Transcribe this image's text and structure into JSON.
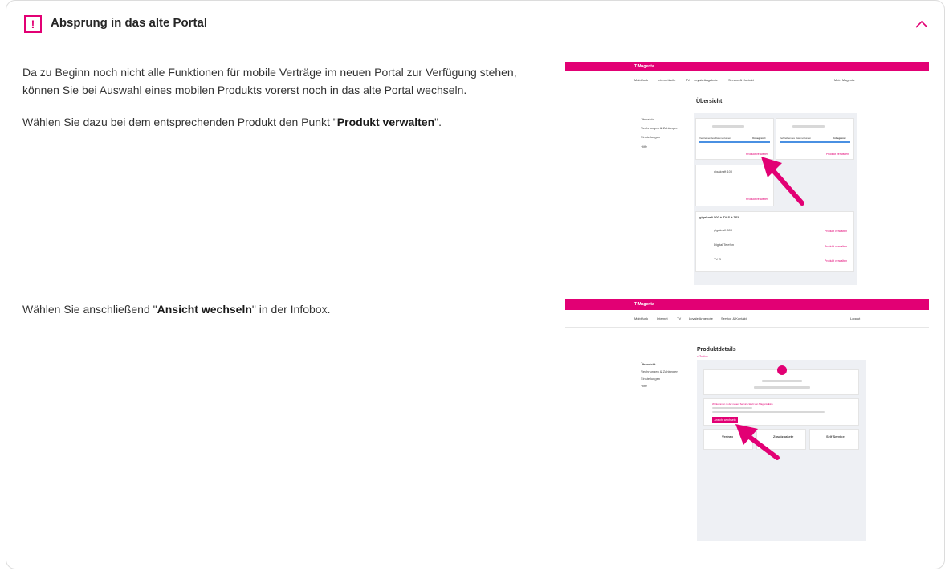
{
  "header": {
    "title": "Absprung in das alte Portal",
    "warning_glyph": "!",
    "accent_color": "#e20074"
  },
  "content": {
    "p1": "Da zu Beginn noch nicht alle Funktionen für mobile Verträge im neuen Portal zur Verfügung stehen, können Sie bei Auswahl eines mobilen Produkts vorerst noch in das alte Portal wechseln.",
    "p2_pre": "Wählen Sie dazu bei dem entsprechenden Produkt den Punkt \"",
    "p2_bold": "Produkt verwalten",
    "p2_post": "\".",
    "p3_pre": "Wählen Sie anschließend \"",
    "p3_bold": "Ansicht wechseln",
    "p3_post": "\" in der Infobox."
  },
  "shot1": {
    "brand": "T Magenta",
    "nav": [
      "Mobilfunk",
      "Internettarife",
      "TV",
      "Loyale Angebote",
      "Service & Kontakt"
    ],
    "account": "Mein Magenta",
    "title": "Übersicht",
    "sidebar": [
      "Übersicht",
      "Rechnungen & Zahlungen",
      "Einstellungen",
      "Hilfe"
    ],
    "card_label": "Verbleibendes Datenvolumen",
    "card_value": "Unbegrenzt",
    "manage": "Produkt verwalten",
    "product1": "gigakraft 100",
    "group": "gigakraft 500 + TV S + TEL",
    "rows": [
      "gigakraft 500",
      "Digital Telefon",
      "TV S"
    ]
  },
  "shot2": {
    "brand": "T Magenta",
    "nav": [
      "Mobilfunk",
      "Internet",
      "TV",
      "Loyale Angebote",
      "Service & Kontakt"
    ],
    "logout": "Logout",
    "title": "Produktdetails",
    "back": "< Zurück",
    "sidebar": [
      "Übersicht",
      "Rechnungen & Zahlungen",
      "Einstellungen",
      "Hilfe"
    ],
    "infobox_title": "Willkommen in der neuen Service-Welt von MagentaEins",
    "button": "Ansicht wechseln",
    "tiles": [
      "Vertrag",
      "Zusatzpakete",
      "Self Service"
    ]
  }
}
